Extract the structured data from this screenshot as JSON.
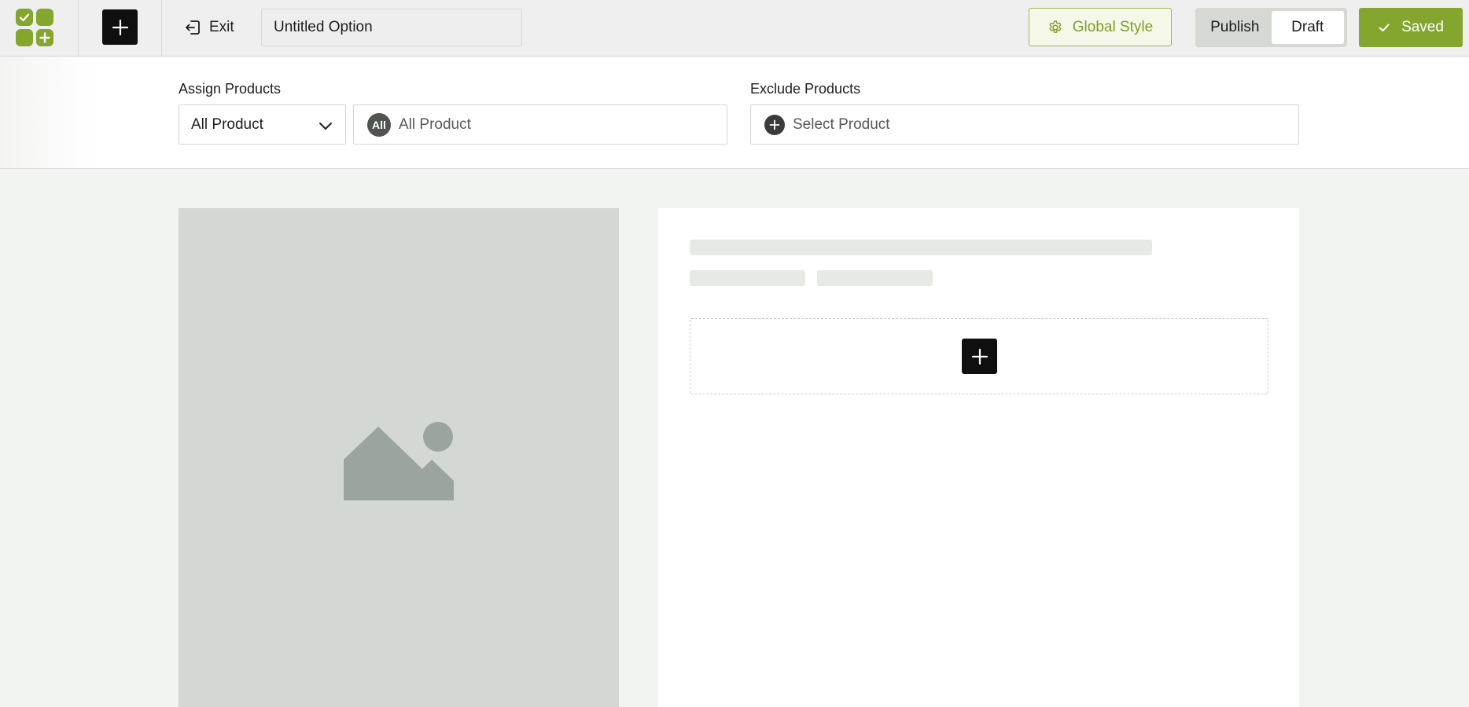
{
  "header": {
    "logo_icon": "app-grid-logo",
    "add_icon": "plus-icon",
    "exit_label": "Exit",
    "exit_icon": "exit-icon",
    "title_value": "Untitled Option",
    "global_style_label": "Global Style",
    "global_style_icon": "gear-icon",
    "status_toggle": {
      "options": [
        "Publish",
        "Draft"
      ],
      "selected": "Draft"
    },
    "saved_label": "Saved",
    "saved_icon": "check-icon"
  },
  "assign": {
    "assign_label": "Assign Products",
    "assign_mode_value": "All Product",
    "assign_tag_badge": "All",
    "assign_tag_text": "All Product",
    "exclude_label": "Exclude Products",
    "exclude_placeholder": "Select Product"
  },
  "canvas": {
    "image_icon": "image-placeholder-icon",
    "add_block_icon": "plus-icon"
  },
  "colors": {
    "brand": "#84a62e",
    "dark": "#0f0f0f",
    "placeholder": "#d4d8d3",
    "skeleton": "#e6e9e4"
  }
}
